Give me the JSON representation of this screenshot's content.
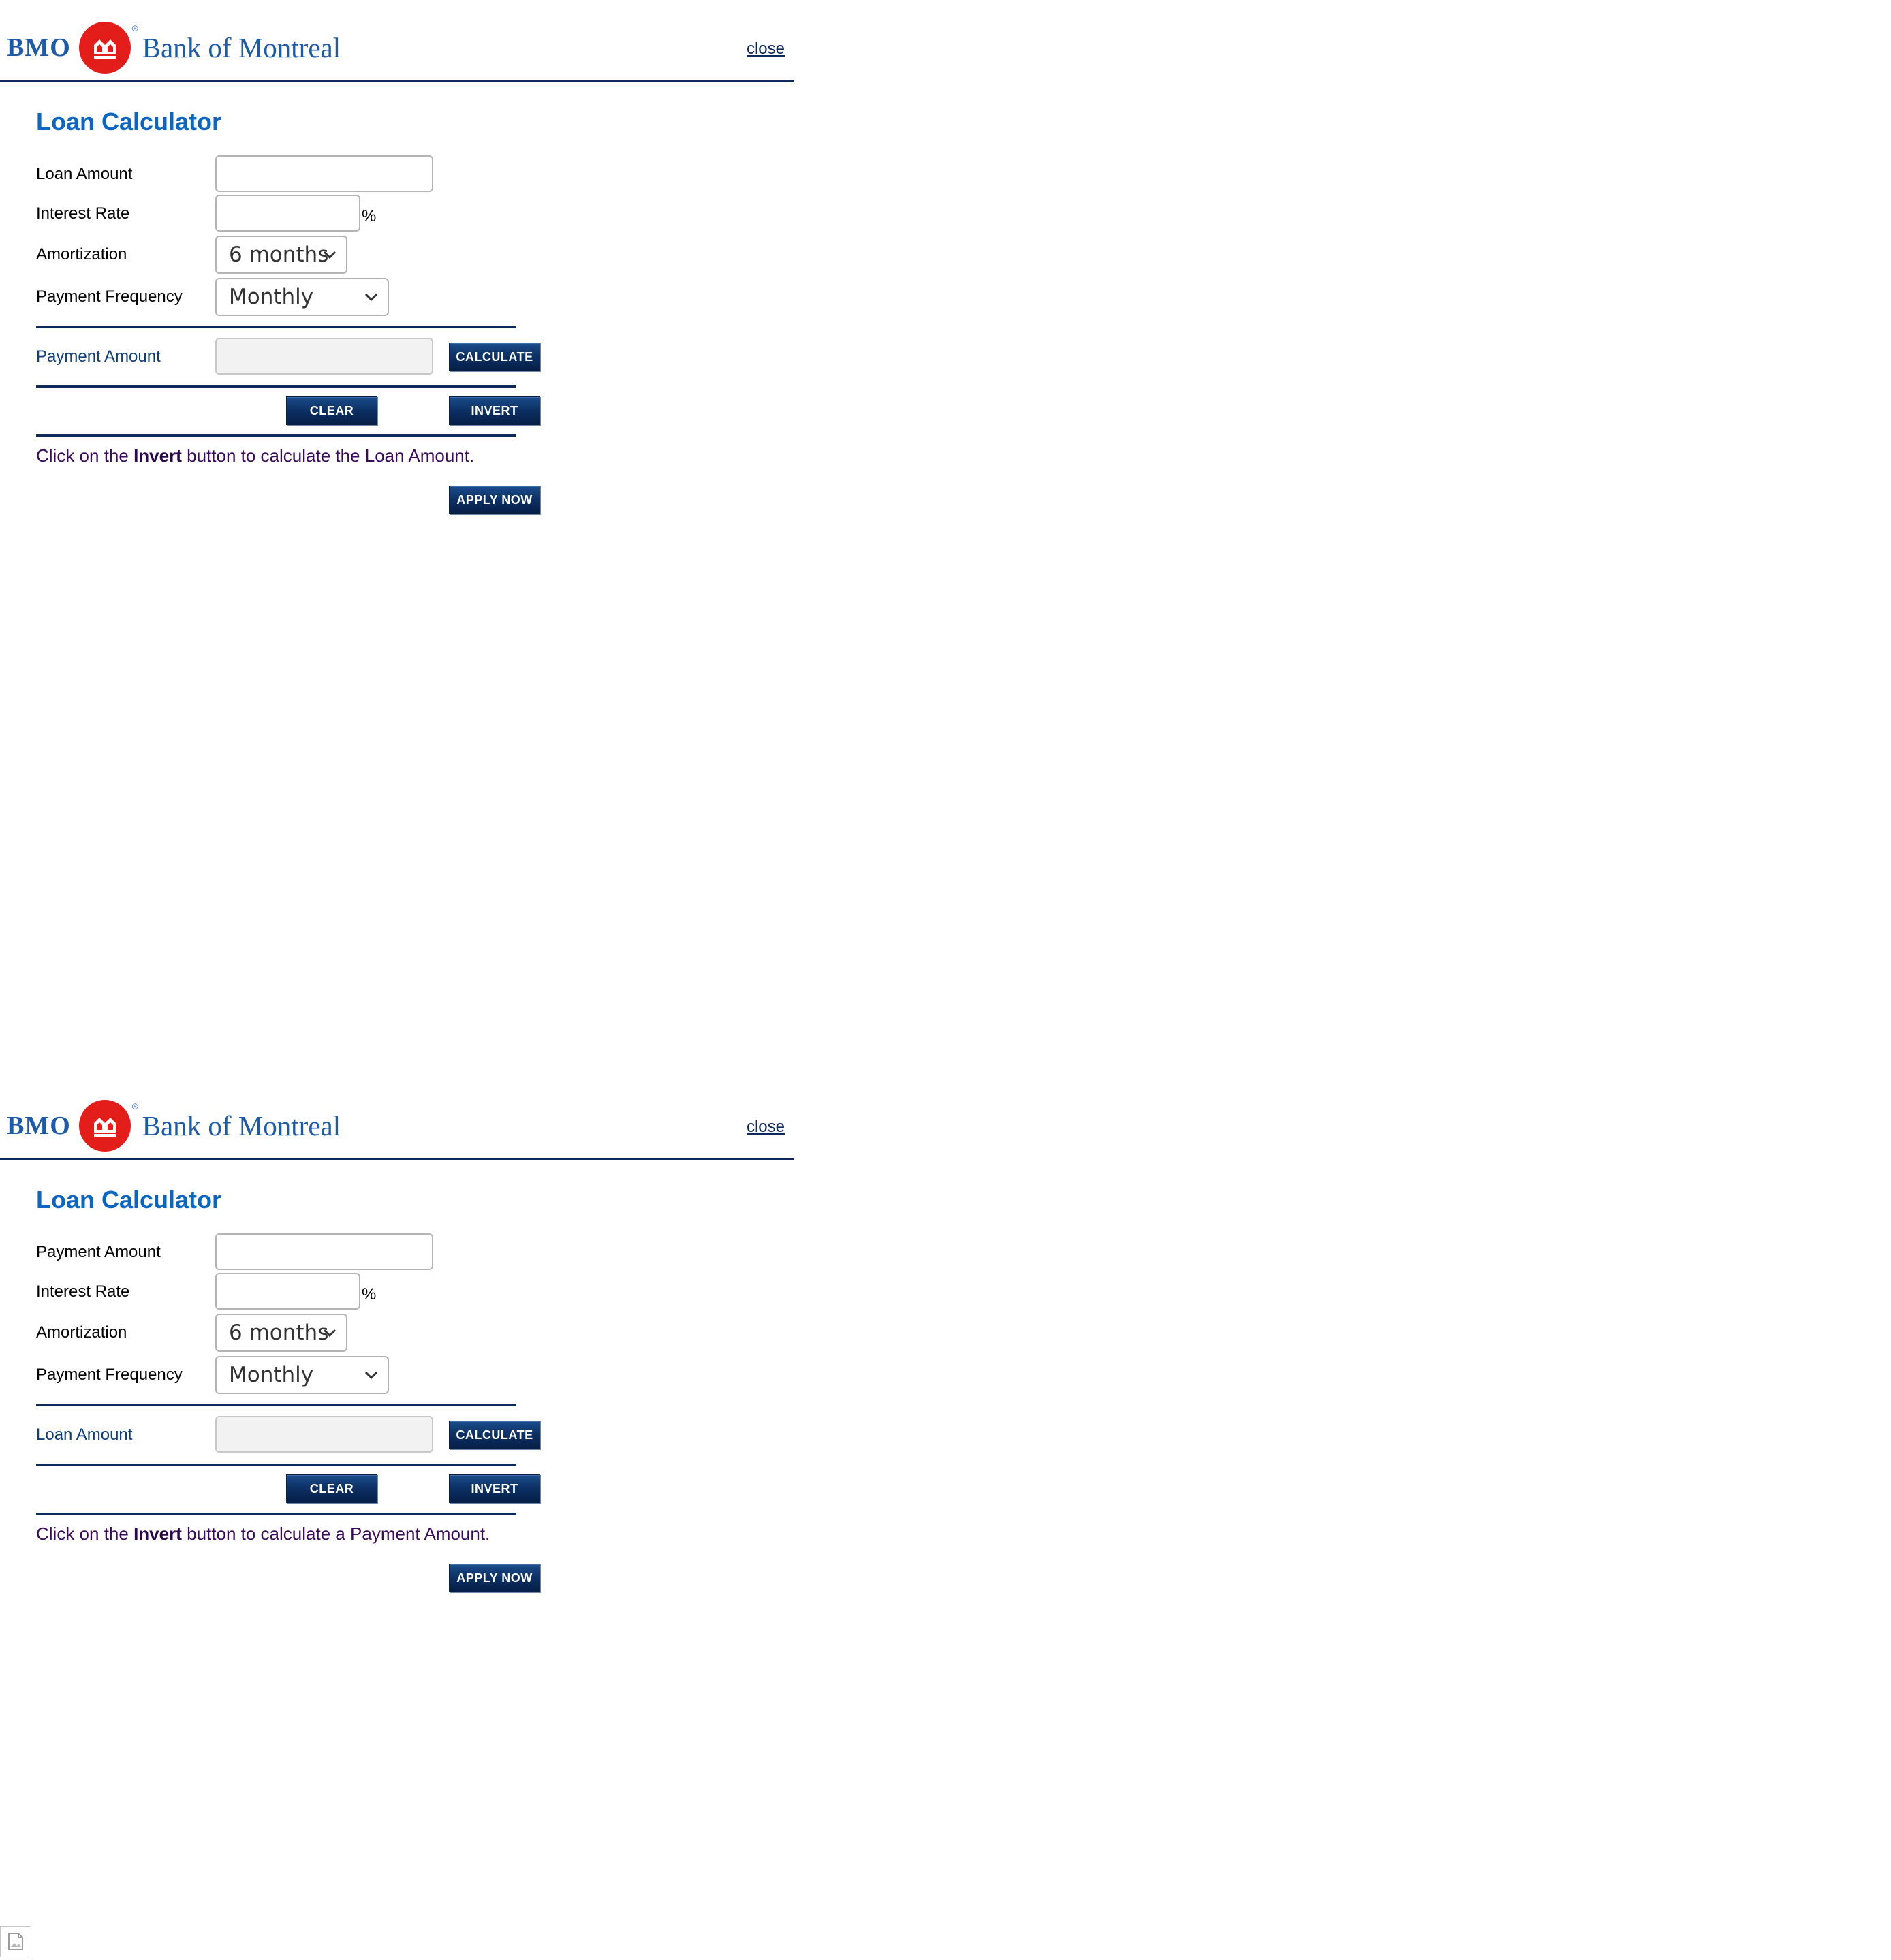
{
  "brand": {
    "short": "BMO",
    "reg_mark": "®",
    "name": "Bank of Montreal",
    "colors": {
      "blue": "#1d5aa8",
      "red": "#e31d1a",
      "navy": "#0d2a5c",
      "title_blue": "#0a66c2"
    }
  },
  "pages": [
    {
      "close_label": "close",
      "title": "Loan Calculator",
      "fields": {
        "first_label": "Loan Amount",
        "first_value": "",
        "rate_label": "Interest Rate",
        "rate_value": "",
        "percent_sign": "%",
        "amortization_label": "Amortization",
        "amortization_value": "6 months",
        "frequency_label": "Payment Frequency",
        "frequency_value": "Monthly",
        "result_label": "Payment Amount",
        "result_value": ""
      },
      "buttons": {
        "calculate": "CALCULATE",
        "clear": "CLEAR",
        "invert": "INVERT",
        "apply": "APPLY NOW"
      },
      "note": {
        "prefix": "Click on the ",
        "bold": "Invert",
        "suffix": " button to calculate the Loan Amount."
      }
    },
    {
      "close_label": "close",
      "title": "Loan Calculator",
      "fields": {
        "first_label": "Payment Amount",
        "first_value": "",
        "rate_label": "Interest Rate",
        "rate_value": "",
        "percent_sign": "%",
        "amortization_label": "Amortization",
        "amortization_value": "6 months",
        "frequency_label": "Payment Frequency",
        "frequency_value": "Monthly",
        "result_label": "Loan Amount",
        "result_value": ""
      },
      "buttons": {
        "calculate": "CALCULATE",
        "clear": "CLEAR",
        "invert": "INVERT",
        "apply": "APPLY NOW"
      },
      "note": {
        "prefix": "Click on the ",
        "bold": "Invert",
        "suffix": " button to calculate a Payment Amount."
      }
    }
  ]
}
